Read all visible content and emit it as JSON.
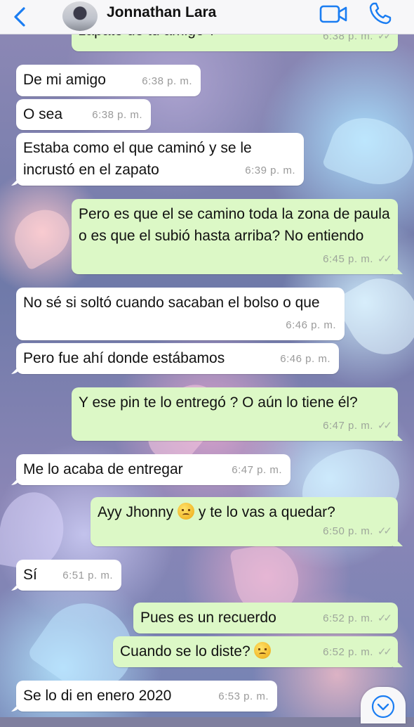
{
  "header": {
    "contact_name": "Jonnathan Lara"
  },
  "icons": {
    "back": "chevron-left-icon",
    "video": "video-camera-icon",
    "call": "phone-icon",
    "scroll": "chevron-down-icon"
  },
  "colors": {
    "accent": "#1a7df2",
    "incoming_bubble": "#ffffff",
    "outgoing_bubble": "#dcf8c6",
    "header_bg": "#f7f7f9"
  },
  "messages": [
    {
      "dir": "out",
      "text": "zapato de tu amigo ?",
      "time": "6:38 p. m.",
      "read": true
    },
    {
      "dir": "in",
      "text": "De mi amigo",
      "time": "6:38 p. m."
    },
    {
      "dir": "in",
      "text": "O sea",
      "time": "6:38 p. m."
    },
    {
      "dir": "in",
      "text": "Estaba como el que caminó y se le incrustó en el zapato",
      "time": "6:39 p. m."
    },
    {
      "dir": "out",
      "text": "Pero es que el se camino toda la zona de paula o es que el subió hasta arriba? No entiendo",
      "time": "6:45 p. m.",
      "read": true
    },
    {
      "dir": "in",
      "text": "No sé si soltó cuando sacaban el bolso o que",
      "time": "6:46 p. m."
    },
    {
      "dir": "in",
      "text": "Pero fue ahí donde estábamos",
      "time": "6:46 p. m."
    },
    {
      "dir": "out",
      "text": "Y ese pin te lo entregó ?  O aún lo tiene él?",
      "time": "6:47 p. m.",
      "read": true
    },
    {
      "dir": "in",
      "text": "Me lo acaba de entregar",
      "time": "6:47 p. m."
    },
    {
      "dir": "out",
      "text_before": "Ayy Jhonny",
      "text_after": "y te lo vas a quedar?",
      "emoji": "disappointed-face",
      "time": "6:50 p. m.",
      "read": true
    },
    {
      "dir": "in",
      "text": "Sí",
      "time": "6:51 p. m."
    },
    {
      "dir": "out",
      "text": "Pues es un recuerdo",
      "time": "6:52 p. m.",
      "read": true
    },
    {
      "dir": "out",
      "text": "Cuando se lo diste?",
      "emoji": "pensive-face",
      "time": "6:52 p. m.",
      "read": true
    },
    {
      "dir": "in",
      "text": "Se lo di en enero 2020",
      "time": "6:53 p. m."
    }
  ]
}
